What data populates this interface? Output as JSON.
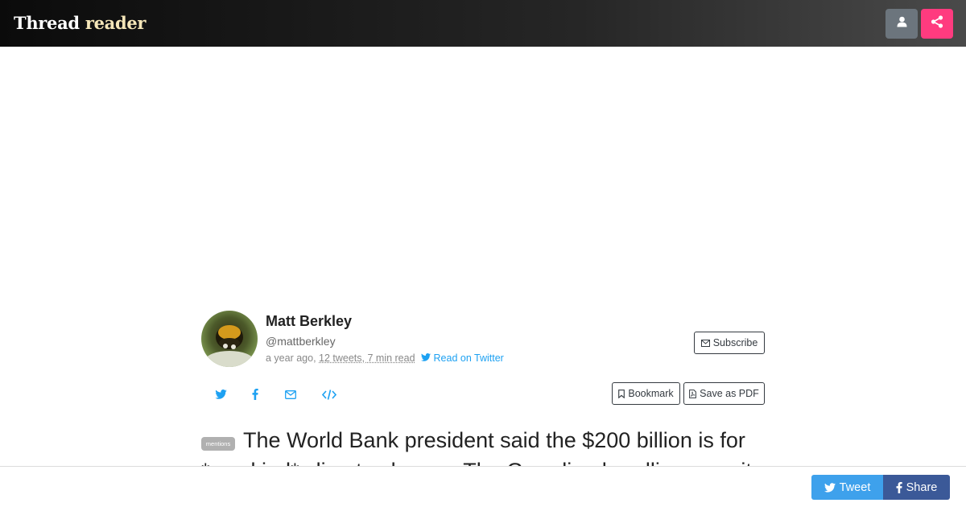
{
  "header": {
    "brand_part1": "Thread",
    "brand_part2": "reader",
    "user_icon": "user-icon",
    "share_icon": "share-alt-icon",
    "colors": {
      "user_button": "#6c757d",
      "share_button": "#ff3b7f"
    }
  },
  "author": {
    "name": "Matt Berkley",
    "handle": "@mattberkley",
    "posted": "a year ago,",
    "stats": "12 tweets, 7 min read",
    "read_on_twitter": "Read on Twitter",
    "avatar_icon": "avatar-bumblebee"
  },
  "actions": {
    "subscribe": "Subscribe",
    "bookmark": "Bookmark",
    "save_pdf": "Save as PDF",
    "share_icons": [
      "twitter-icon",
      "facebook-icon",
      "envelope-icon",
      "code-icon"
    ]
  },
  "thread": {
    "badge": "mentions",
    "text": "The World Bank president said the $200 billion is for *any kind* climate change. The Guardian headline says it"
  },
  "footer": {
    "tweet": "Tweet",
    "share": "Share",
    "colors": {
      "tweet": "#3ea1ec",
      "share": "#3b5998"
    }
  }
}
